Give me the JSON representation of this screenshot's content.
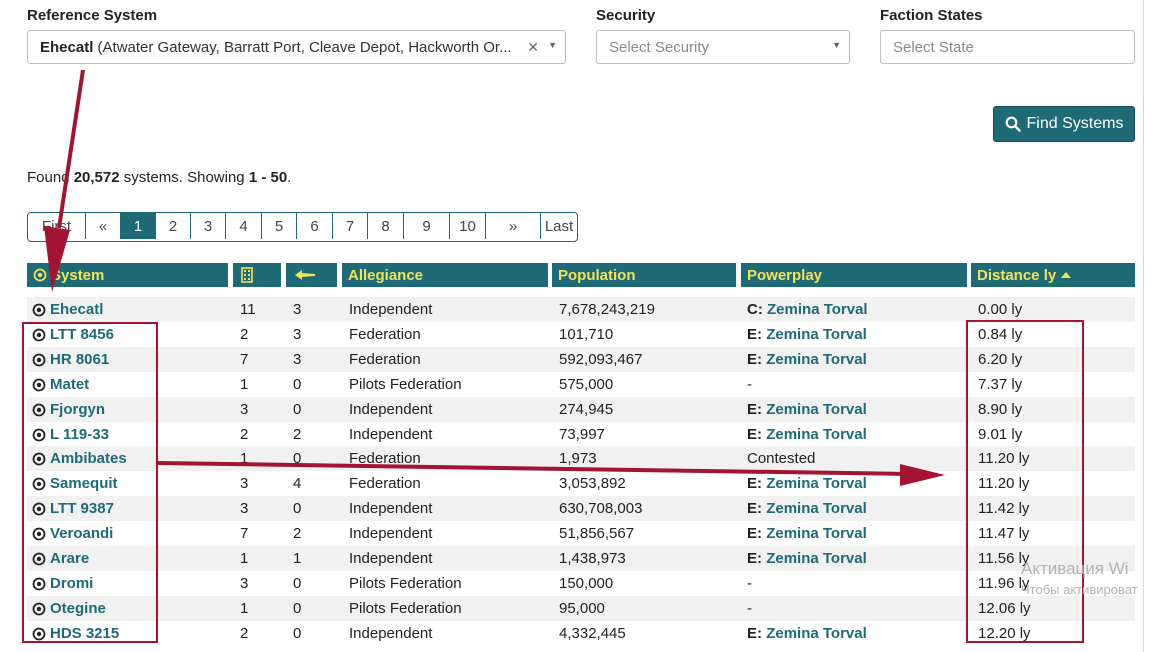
{
  "filters": {
    "reference_label": "Reference System",
    "reference_system": "Ehecatl",
    "reference_stations": "(Atwater Gateway, Barratt Port, Cleave Depot, Hackworth Or...",
    "security_label": "Security",
    "security_placeholder": "Select Security",
    "faction_label": "Faction States",
    "faction_placeholder": "Select State",
    "find_label": "Find Systems"
  },
  "results": {
    "found_prefix": "Found ",
    "found_count": "20,572",
    "found_mid": " systems. Showing ",
    "found_range": "1 - 50",
    "found_suffix": "."
  },
  "pagination": [
    "First",
    "«",
    "1",
    "2",
    "3",
    "4",
    "5",
    "6",
    "7",
    "8",
    "9",
    "10",
    "»",
    "Last"
  ],
  "active_page": "1",
  "columns": [
    "System",
    "",
    "",
    "Allegiance",
    "Population",
    "Powerplay",
    "Distance ly"
  ],
  "rows": [
    {
      "system": "Ehecatl",
      "stations": "11",
      "planets": "3",
      "allegiance": "Independent",
      "population": "7,678,243,219",
      "pp_state": "C",
      "pp_power": "Zemina Torval",
      "distance": "0.00 ly"
    },
    {
      "system": "LTT 8456",
      "stations": "2",
      "planets": "3",
      "allegiance": "Federation",
      "population": "101,710",
      "pp_state": "E",
      "pp_power": "Zemina Torval",
      "distance": "0.84 ly"
    },
    {
      "system": "HR 8061",
      "stations": "7",
      "planets": "3",
      "allegiance": "Federation",
      "population": "592,093,467",
      "pp_state": "E",
      "pp_power": "Zemina Torval",
      "distance": "6.20 ly"
    },
    {
      "system": "Matet",
      "stations": "1",
      "planets": "0",
      "allegiance": "Pilots Federation",
      "population": "575,000",
      "pp_state": "",
      "pp_power": "-",
      "distance": "7.37 ly"
    },
    {
      "system": "Fjorgyn",
      "stations": "3",
      "planets": "0",
      "allegiance": "Independent",
      "population": "274,945",
      "pp_state": "E",
      "pp_power": "Zemina Torval",
      "distance": "8.90 ly"
    },
    {
      "system": "L 119-33",
      "stations": "2",
      "planets": "2",
      "allegiance": "Independent",
      "population": "73,997",
      "pp_state": "E",
      "pp_power": "Zemina Torval",
      "distance": "9.01 ly"
    },
    {
      "system": "Ambibates",
      "stations": "1",
      "planets": "0",
      "allegiance": "Federation",
      "population": "1,973",
      "pp_state": "",
      "pp_power": "Contested",
      "distance": "11.20 ly"
    },
    {
      "system": "Samequit",
      "stations": "3",
      "planets": "4",
      "allegiance": "Federation",
      "population": "3,053,892",
      "pp_state": "E",
      "pp_power": "Zemina Torval",
      "distance": "11.20 ly"
    },
    {
      "system": "LTT 9387",
      "stations": "3",
      "planets": "0",
      "allegiance": "Independent",
      "population": "630,708,003",
      "pp_state": "E",
      "pp_power": "Zemina Torval",
      "distance": "11.42 ly"
    },
    {
      "system": "Veroandi",
      "stations": "7",
      "planets": "2",
      "allegiance": "Independent",
      "population": "51,856,567",
      "pp_state": "E",
      "pp_power": "Zemina Torval",
      "distance": "11.47 ly"
    },
    {
      "system": "Arare",
      "stations": "1",
      "planets": "1",
      "allegiance": "Independent",
      "population": "1,438,973",
      "pp_state": "E",
      "pp_power": "Zemina Torval",
      "distance": "11.56 ly"
    },
    {
      "system": "Dromi",
      "stations": "3",
      "planets": "0",
      "allegiance": "Pilots Federation",
      "population": "150,000",
      "pp_state": "",
      "pp_power": "-",
      "distance": "11.96 ly"
    },
    {
      "system": "Otegine",
      "stations": "1",
      "planets": "0",
      "allegiance": "Pilots Federation",
      "population": "95,000",
      "pp_state": "",
      "pp_power": "-",
      "distance": "12.06 ly"
    },
    {
      "system": "HDS 3215",
      "stations": "2",
      "planets": "0",
      "allegiance": "Independent",
      "population": "4,332,445",
      "pp_state": "E",
      "pp_power": "Zemina Torval",
      "distance": "12.20 ly"
    }
  ],
  "watermark": {
    "line1": "Активация Wi",
    "line2": "Чтобы активироват"
  },
  "colors": {
    "accent": "#1e6a77",
    "header_text": "#f2e35a",
    "annotation": "#a31432"
  }
}
